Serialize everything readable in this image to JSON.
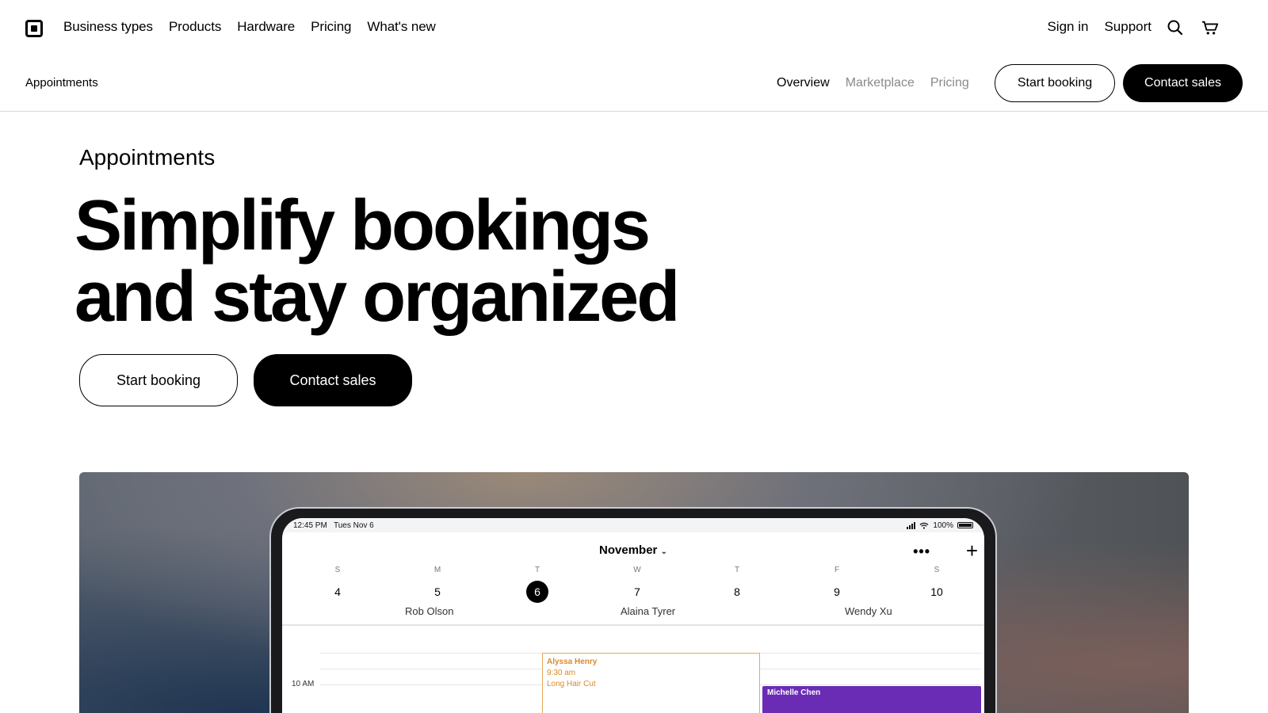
{
  "topnav": {
    "main_links": [
      "Business types",
      "Products",
      "Hardware",
      "Pricing",
      "What's new"
    ],
    "right_links": [
      "Sign in",
      "Support"
    ]
  },
  "subnav": {
    "title": "Appointments",
    "links": [
      {
        "label": "Overview",
        "active": true
      },
      {
        "label": "Marketplace",
        "active": false
      },
      {
        "label": "Pricing",
        "active": false
      }
    ],
    "start_label": "Start booking",
    "contact_label": "Contact sales"
  },
  "hero": {
    "eyebrow": "Appointments",
    "headline_line1": "Simplify bookings",
    "headline_line2": "and stay organized",
    "start_label": "Start booking",
    "contact_label": "Contact sales"
  },
  "tablet": {
    "status": {
      "time": "12:45 PM",
      "date": "Tues Nov 6",
      "battery": "100%"
    },
    "month": "November",
    "days": [
      {
        "dow": "S",
        "num": "4"
      },
      {
        "dow": "M",
        "num": "5"
      },
      {
        "dow": "T",
        "num": "6",
        "selected": true
      },
      {
        "dow": "W",
        "num": "7"
      },
      {
        "dow": "T",
        "num": "8"
      },
      {
        "dow": "F",
        "num": "9"
      },
      {
        "dow": "S",
        "num": "10"
      }
    ],
    "staff": [
      "Rob Olson",
      "Alaina Tyrer",
      "Wendy Xu"
    ],
    "time_label": "10 AM",
    "appointment": {
      "name": "Alyssa Henry",
      "time": "9:30 am",
      "service": "Long Hair Cut"
    },
    "appointment2": {
      "name": "Michelle Chen"
    }
  }
}
